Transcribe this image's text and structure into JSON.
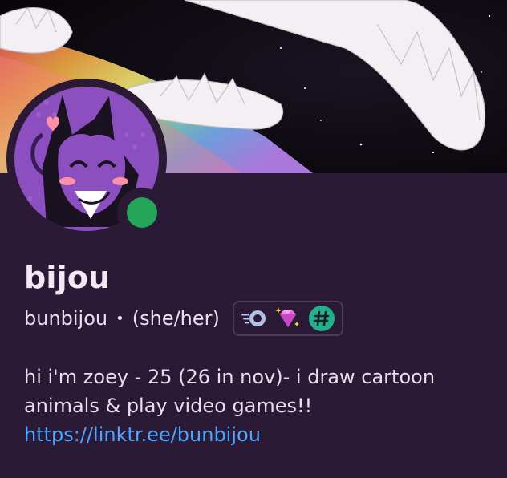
{
  "profile": {
    "display_name": "bijou",
    "username": "bunbijou",
    "separator": "•",
    "pronouns": "(she/her)",
    "status": "online",
    "bio": {
      "line1": "hi i'm zoey - 25 (26 in nov)- i draw cartoon",
      "line2": "animals & play video games!!",
      "link": "https://linktr.ee/bunbijou"
    }
  },
  "badges": [
    {
      "icon": "nitro-icon"
    },
    {
      "icon": "boost-gem-icon"
    },
    {
      "icon": "hashtag-badge-icon"
    }
  ],
  "colors": {
    "background": "#2b1a35",
    "status_online": "#23a55a",
    "link": "#4fa4ff",
    "name_text": "#f2e9f5",
    "body_text": "#eadff0"
  }
}
